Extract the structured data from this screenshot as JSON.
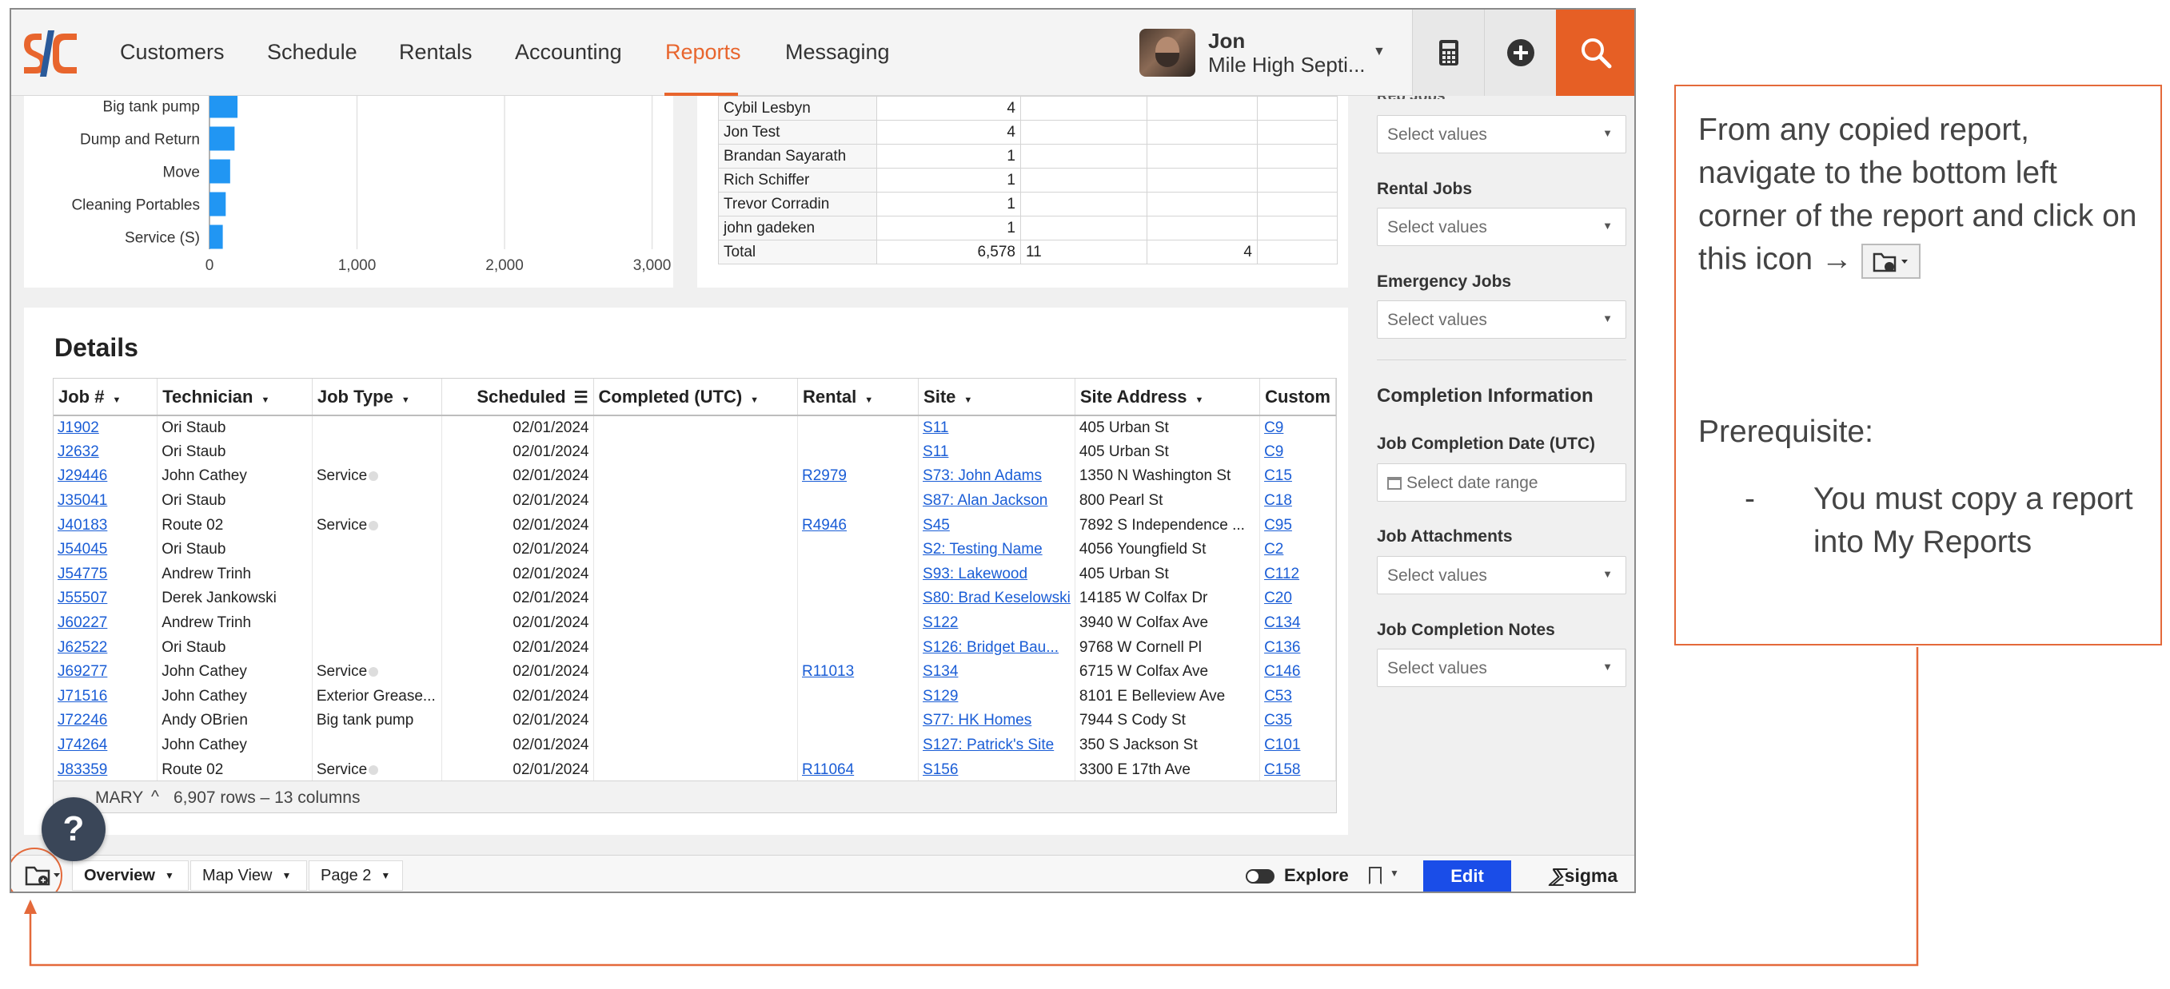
{
  "nav": {
    "items": [
      "Customers",
      "Schedule",
      "Rentals",
      "Accounting",
      "Reports",
      "Messaging"
    ],
    "active": "Reports",
    "user_name": "Jon",
    "user_company": "Mile High Septi..."
  },
  "chart": {
    "type": "bar",
    "orientation": "horizontal",
    "categories": [
      "Big tank pump",
      "Dump and Return",
      "Move",
      "Cleaning Portables",
      "Service (S)"
    ],
    "values": [
      190,
      170,
      140,
      110,
      90
    ],
    "xlim": [
      0,
      3100
    ],
    "ticks": [
      "0",
      "1,000",
      "2,000",
      "3,000"
    ],
    "color": "#2196f3"
  },
  "pivot": {
    "rows": [
      [
        "Cybil Lesbyn",
        "4",
        "",
        "",
        ""
      ],
      [
        "Jon Test",
        "4",
        "",
        "",
        ""
      ],
      [
        "Brandan Sayarath",
        "1",
        "",
        "",
        ""
      ],
      [
        "Rich Schiffer",
        "1",
        "",
        "",
        ""
      ],
      [
        "Trevor Corradin",
        "1",
        "",
        "",
        ""
      ],
      [
        "john gadeken",
        "1",
        "",
        "",
        ""
      ],
      [
        "Total",
        "6,578",
        "11",
        "4",
        ""
      ]
    ]
  },
  "details": {
    "title": "Details",
    "columns": [
      "Job #",
      "Technician",
      "Job Type",
      "Scheduled",
      "Completed (UTC)",
      "Rental",
      "Site",
      "Site Address",
      "Custom"
    ],
    "rows": [
      [
        "J1902",
        "Ori Staub",
        "",
        "02/01/2024",
        "",
        "",
        "S11",
        "405 Urban St",
        "C9"
      ],
      [
        "J2632",
        "Ori Staub",
        "",
        "02/01/2024",
        "",
        "",
        "S11",
        "405 Urban St",
        "C9"
      ],
      [
        "J29446",
        "John Cathey",
        "Service",
        "02/01/2024",
        "",
        "R2979",
        "S73: John Adams",
        "1350 N Washington St",
        "C15"
      ],
      [
        "J35041",
        "Ori Staub",
        "",
        "02/01/2024",
        "",
        "",
        "S87: Alan Jackson",
        "800 Pearl St",
        "C18"
      ],
      [
        "J40183",
        "Route 02",
        "Service",
        "02/01/2024",
        "",
        "R4946",
        "S45",
        "7892 S Independence ...",
        "C95"
      ],
      [
        "J54045",
        "Ori Staub",
        "",
        "02/01/2024",
        "",
        "",
        "S2: Testing Name",
        "4056 Youngfield St",
        "C2"
      ],
      [
        "J54775",
        "Andrew Trinh",
        "",
        "02/01/2024",
        "",
        "",
        "S93: Lakewood",
        "405 Urban St",
        "C112"
      ],
      [
        "J55507",
        "Derek  Jankowski",
        "",
        "02/01/2024",
        "",
        "",
        "S80: Brad Keselowski",
        "14185 W Colfax Dr",
        "C20"
      ],
      [
        "J60227",
        "Andrew Trinh",
        "",
        "02/01/2024",
        "",
        "",
        "S122",
        "3940 W Colfax Ave",
        "C134"
      ],
      [
        "J62522",
        "Ori Staub",
        "",
        "02/01/2024",
        "",
        "",
        "S126: Bridget Bau...",
        "9768 W Cornell Pl",
        "C136"
      ],
      [
        "J69277",
        "John Cathey",
        "Service",
        "02/01/2024",
        "",
        "R11013",
        "S134",
        "6715 W Colfax Ave",
        "C146"
      ],
      [
        "J71516",
        "John Cathey",
        "Exterior Grease...",
        "02/01/2024",
        "",
        "",
        "S129",
        "8101 E Belleview Ave",
        "C53"
      ],
      [
        "J72246",
        "Andy OBrien",
        "Big tank pump",
        "02/01/2024",
        "",
        "",
        "S77: HK Homes",
        "7944 S Cody St",
        "C35"
      ],
      [
        "J74264",
        "John Cathey",
        "",
        "02/01/2024",
        "",
        "",
        "S127: Patrick's Site",
        "350 S Jackson St",
        "C101"
      ],
      [
        "J83359",
        "Route 02",
        "Service",
        "02/01/2024",
        "",
        "R11064",
        "S156",
        "3300 E 17th Ave",
        "C158"
      ]
    ],
    "summary_label": "MARY",
    "summary_count": "6,907 rows – 13 columns"
  },
  "sidebar": {
    "filters": [
      {
        "label": "",
        "placeholder": "Select values"
      },
      {
        "label": "Rental Jobs",
        "placeholder": "Select values"
      },
      {
        "label": "Emergency Jobs",
        "placeholder": "Select values"
      }
    ],
    "section_title": "Completion Information",
    "completion_date_label": "Job Completion Date (UTC)",
    "completion_date_placeholder": "Select date range",
    "attachments_label": "Job Attachments",
    "attachments_placeholder": "Select values",
    "notes_label": "Job Completion Notes",
    "notes_placeholder": "Select values"
  },
  "bottom": {
    "tabs": [
      "Overview",
      "Map View",
      "Page 2"
    ],
    "explore": "Explore",
    "edit": "Edit",
    "brand": "sigma"
  },
  "help": "?",
  "callout": {
    "text1": "From any copied report, navigate to the bottom left corner of the report and click on this icon →",
    "prereq": "Prerequisite:",
    "bullet_dash": "-",
    "bullet": "You must copy a report into My Reports"
  },
  "colors": {
    "accent": "#e8652d",
    "link": "#1a5dd6",
    "edit_button": "#1a4de8",
    "callout_border": "#e4693a"
  }
}
